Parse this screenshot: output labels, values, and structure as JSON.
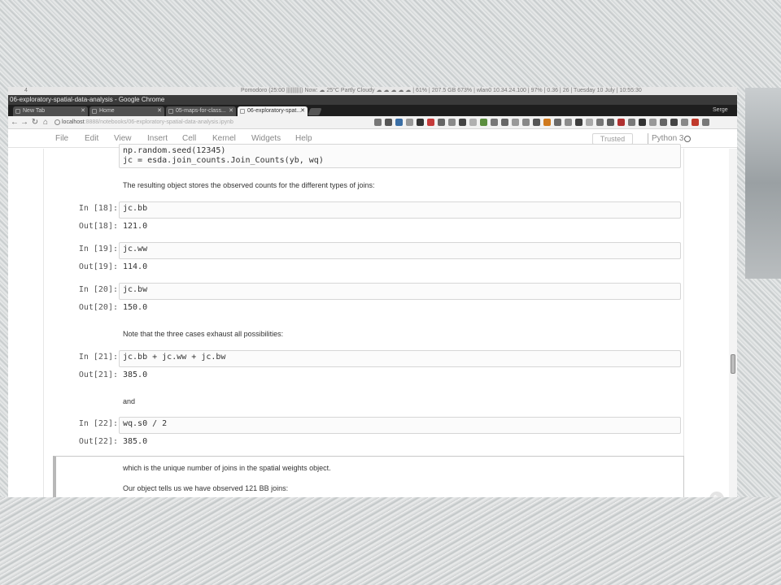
{
  "os_bar": {
    "left_text": "4",
    "status_text": "Pomodoro (25:00 ||||||||||) Now: ☁ 25°C Partly Cloudy ☁ ☁ ☁ ☁ ☁ | 61% | 207.5 GB 673% | wlan0 10.34.24.100 | 97% | 0.36 | 26 | Tuesday 10 July | 10:55:30"
  },
  "window": {
    "title": "06-exploratory-spatial-data-analysis - Google Chrome"
  },
  "tabs": [
    {
      "label": "New Tab",
      "active": false
    },
    {
      "label": "Home",
      "active": false
    },
    {
      "label": "05-maps-for-class...",
      "active": false
    },
    {
      "label": "06-exploratory-spat...",
      "active": true
    }
  ],
  "profile_name": "Serge",
  "address": {
    "host": "localhost",
    "path": ":8888/notebooks/06-exploratory-spatial-data-analysis.ipynb",
    "extension_colors": [
      "#777777",
      "#555555",
      "#3a6ea5",
      "#999999",
      "#333333",
      "#c53b3b",
      "#666666",
      "#8a8a8a",
      "#444444",
      "#b0b0b0",
      "#5b8e3e",
      "#777777",
      "#666666",
      "#999999",
      "#888888",
      "#555555",
      "#d07a1e",
      "#6a6a6a",
      "#8c8c8c",
      "#3d3d3d",
      "#aaaaaa",
      "#777777",
      "#5c5c5c",
      "#b03030",
      "#7a7a7a",
      "#333333",
      "#999999",
      "#666666",
      "#444444",
      "#888888",
      "#c0392b",
      "#777777"
    ]
  },
  "menu": {
    "items": [
      "File",
      "Edit",
      "View",
      "Insert",
      "Cell",
      "Kernel",
      "Widgets",
      "Help"
    ],
    "trusted": "Trusted",
    "kernel": "Python 3"
  },
  "cells": {
    "c0_line1": "np.random.seed(12345)",
    "c0_line2": "jc = esda.join_counts.Join_Counts(yb, wq)",
    "md1": "The resulting object stores the observed counts for the different types of joins:",
    "c18_in": "In [18]:",
    "c18_code": "jc.bb",
    "c18_out": "Out[18]:",
    "c18_val": "121.0",
    "c19_in": "In [19]:",
    "c19_code": "jc.ww",
    "c19_out": "Out[19]:",
    "c19_val": "114.0",
    "c20_in": "In [20]:",
    "c20_code": "jc.bw",
    "c20_out": "Out[20]:",
    "c20_val": "150.0",
    "md2": "Note that the three cases exhaust all possibilities:",
    "c21_in": "In [21]:",
    "c21_code": "jc.bb + jc.ww + jc.bw",
    "c21_out": "Out[21]:",
    "c21_val": "385.0",
    "md3": "and",
    "c22_in": "In [22]:",
    "c22_code": "wq.s0 / 2",
    "c22_out": "Out[22]:",
    "c22_val": "385.0",
    "md4": "which is the unique number of joins in the spatial weights object.",
    "md5": "Our object tells us we have observed 121 BB joins:"
  }
}
